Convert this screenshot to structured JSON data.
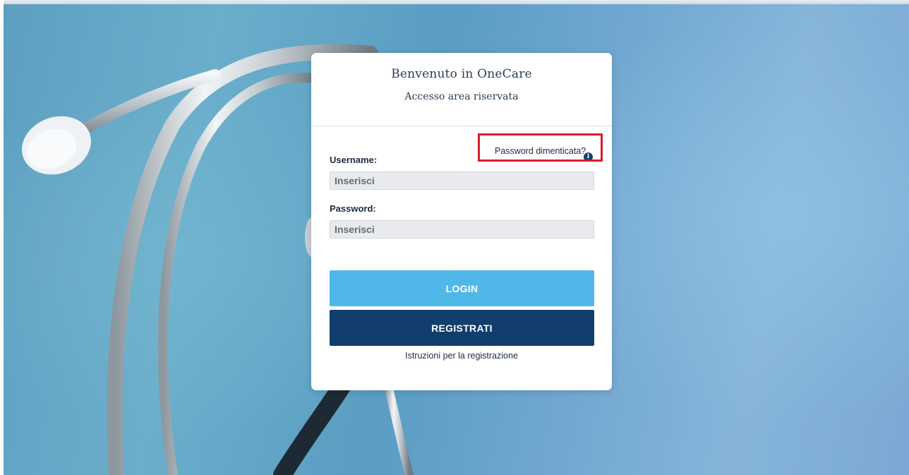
{
  "card": {
    "title": "Benvenuto in OneCare",
    "subtitle": "Accesso area riservata"
  },
  "form": {
    "username_label": "Username:",
    "username_placeholder": "Inserisci",
    "username_value": "",
    "password_label": "Password:",
    "password_placeholder": "Inserisci",
    "password_value": "",
    "info_icon": "info-icon",
    "forgot_password": "Password dimenticata?"
  },
  "buttons": {
    "login": "LOGIN",
    "register": "REGISTRATI"
  },
  "links": {
    "instructions": "Istruzioni per la registrazione"
  },
  "colors": {
    "login_button": "#4fb8e8",
    "register_button": "#113e6c",
    "highlight_box": "#d71d2a",
    "background": "#5e9fc0"
  }
}
